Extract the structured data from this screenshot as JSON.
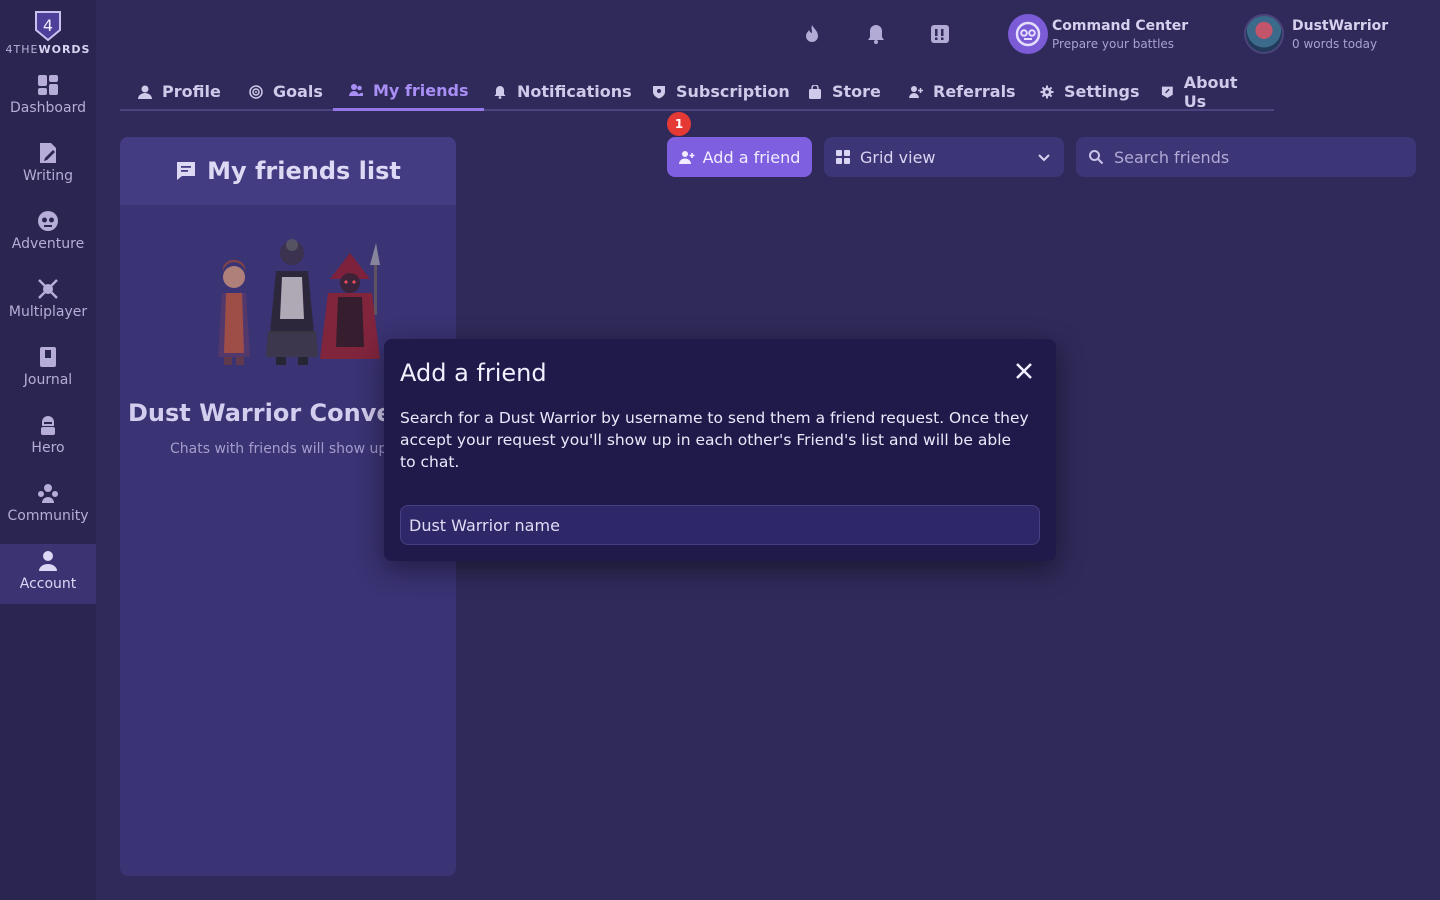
{
  "app": {
    "logo_number": "4",
    "logo_text_light": "4THE",
    "logo_text_bold": "WORDS"
  },
  "sidebar": {
    "items": [
      {
        "label": "Dashboard",
        "icon": "dashboard-icon"
      },
      {
        "label": "Writing",
        "icon": "writing-icon"
      },
      {
        "label": "Adventure",
        "icon": "adventure-icon"
      },
      {
        "label": "Multiplayer",
        "icon": "multiplayer-icon"
      },
      {
        "label": "Journal",
        "icon": "journal-icon"
      },
      {
        "label": "Hero",
        "icon": "hero-icon"
      },
      {
        "label": "Community",
        "icon": "community-icon"
      },
      {
        "label": "Account",
        "icon": "account-icon",
        "active": true
      }
    ]
  },
  "header": {
    "icons": [
      "streak-flame-icon",
      "bell-icon",
      "alert-icon"
    ],
    "command_center": {
      "title": "Command Center",
      "subtitle": "Prepare your battles"
    },
    "user": {
      "name": "DustWarrior",
      "words_today": "0 words today"
    }
  },
  "tabs": [
    {
      "label": "Profile",
      "icon": "person-icon"
    },
    {
      "label": "Goals",
      "icon": "target-icon"
    },
    {
      "label": "My friends",
      "icon": "friends-icon",
      "active": true
    },
    {
      "label": "Notifications",
      "icon": "bell-icon"
    },
    {
      "label": "Subscription",
      "icon": "shield-icon"
    },
    {
      "label": "Store",
      "icon": "bag-icon"
    },
    {
      "label": "Referrals",
      "icon": "add-person-icon"
    },
    {
      "label": "Settings",
      "icon": "gear-icon"
    },
    {
      "label": "About Us",
      "icon": "info-icon"
    }
  ],
  "friends_panel": {
    "title": "My friends list",
    "empty_title": "Dust Warrior Conversa",
    "empty_subtitle": "Chats with friends will show up h"
  },
  "toolbar": {
    "add_friend_label": "Add a friend",
    "badge_count": "1",
    "view_select": "Grid view",
    "search_placeholder": "Search friends"
  },
  "modal": {
    "title": "Add a friend",
    "description": "Search for a Dust Warrior by username to send them a friend request. Once they accept your request you'll show up in each other's Friend's list and will be able to chat.",
    "input_placeholder": "Dust Warrior name"
  },
  "colors": {
    "background": "#2f2a5a",
    "sidebar": "#2a2551",
    "accent": "#7e5fe0",
    "active_tab": "#a98ef5",
    "modal": "#1f1a4a",
    "badge": "#e53935"
  }
}
